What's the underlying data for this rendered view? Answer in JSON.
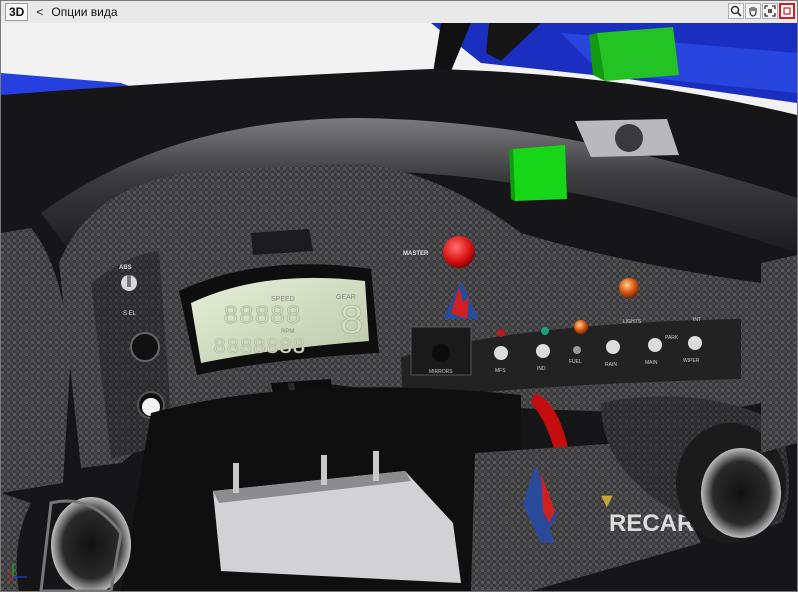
{
  "toolbar": {
    "mode_label": "3D",
    "back_label": "<",
    "title": "Опции вида",
    "tools": [
      "zoom-icon",
      "pan-hand-icon",
      "fit-view-icon",
      "close-view-icon"
    ]
  },
  "dashboard": {
    "abs_label": "ABS",
    "abs_sel": "S EL",
    "display": {
      "speed_label": "SPEED",
      "gear_label": "GEAR",
      "rpm_label": "RPM",
      "speed_digits": "88888",
      "rpm_digits": "8888888",
      "gear_digit": "8"
    },
    "master_label": "MASTER",
    "lights_label": "LIGHTS",
    "int_label": "INT",
    "park_label": "PARK",
    "switches": [
      "MFS",
      "IND",
      "FUEL",
      "RAIN",
      "MAIN",
      "WIPER"
    ],
    "mirror_label": "MIRRORS",
    "brand_label": "RECARO"
  },
  "gizmo": {
    "x_label": "X"
  }
}
